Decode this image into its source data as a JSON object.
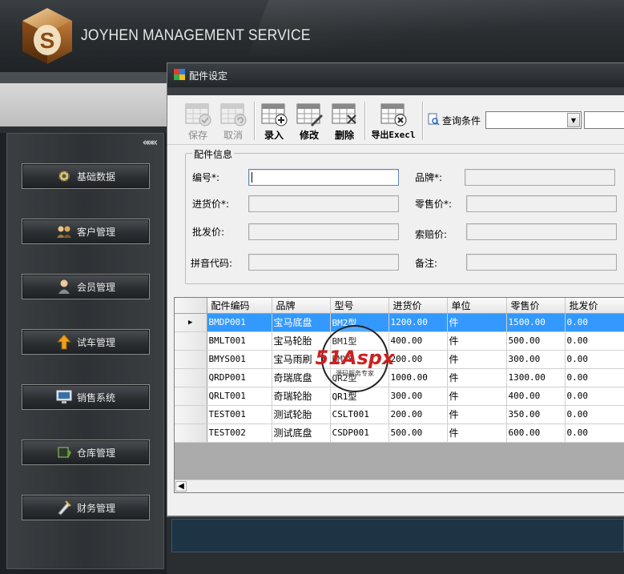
{
  "app": {
    "title": "JOYHEN MANAGEMENT SERVICE",
    "logo_letter": "S"
  },
  "sidebar": {
    "collapse_glyph": "«««",
    "items": [
      {
        "label": "基础数据",
        "icon": "gear-icon"
      },
      {
        "label": "客户管理",
        "icon": "people-icon"
      },
      {
        "label": "会员管理",
        "icon": "person-icon"
      },
      {
        "label": "试车管理",
        "icon": "arrow-icon"
      },
      {
        "label": "销售系统",
        "icon": "monitor-icon"
      },
      {
        "label": "仓库管理",
        "icon": "box-icon"
      },
      {
        "label": "财务管理",
        "icon": "pen-icon"
      }
    ]
  },
  "window": {
    "title": "配件设定",
    "toolbar": {
      "save": "保存",
      "cancel": "取消",
      "add": "录入",
      "edit": "修改",
      "delete": "删除",
      "export": "导出Execl",
      "query_label": "查询条件",
      "query_value": "",
      "query_text": ""
    },
    "form": {
      "legend": "配件信息",
      "code_label": "编号*:",
      "brand_label": "品牌*:",
      "purchase_label": "进货价*:",
      "retail_label": "零售价*:",
      "wholesale_label": "批发价:",
      "claim_label": "索赔价:",
      "pinyin_label": "拼音代码:",
      "remark_label": "备注:",
      "code_value": "",
      "brand_value": "",
      "purchase_value": "",
      "retail_value": "",
      "wholesale_value": "",
      "claim_value": "",
      "pinyin_value": "",
      "remark_value": ""
    },
    "grid": {
      "columns": [
        "配件编码",
        "品牌",
        "型号",
        "进货价",
        "单位",
        "零售价",
        "批发价"
      ],
      "rows": [
        [
          "BMDP001",
          "宝马底盘",
          "BM2型",
          "1200.00",
          "件",
          "1500.00",
          "0.00"
        ],
        [
          "BMLT001",
          "宝马轮胎",
          "BM1型",
          "400.00",
          "件",
          "500.00",
          "0.00"
        ],
        [
          "BMYS001",
          "宝马雨刷",
          "BMYS",
          "200.00",
          "件",
          "300.00",
          "0.00"
        ],
        [
          "QRDP001",
          "奇瑞底盘",
          "QR2型",
          "1000.00",
          "件",
          "1300.00",
          "0.00"
        ],
        [
          "QRLT001",
          "奇瑞轮胎",
          "QR1型",
          "300.00",
          "件",
          "400.00",
          "0.00"
        ],
        [
          "TEST001",
          "测试轮胎",
          "CSLT001",
          "200.00",
          "件",
          "350.00",
          "0.00"
        ],
        [
          "TEST002",
          "测试底盘",
          "CSDP001",
          "500.00",
          "件",
          "600.00",
          "0.00"
        ]
      ],
      "selected_row": 0,
      "row_indicator": "▶"
    }
  },
  "watermark": {
    "brand": "51Aspx",
    "sub": "源码服务专家"
  }
}
